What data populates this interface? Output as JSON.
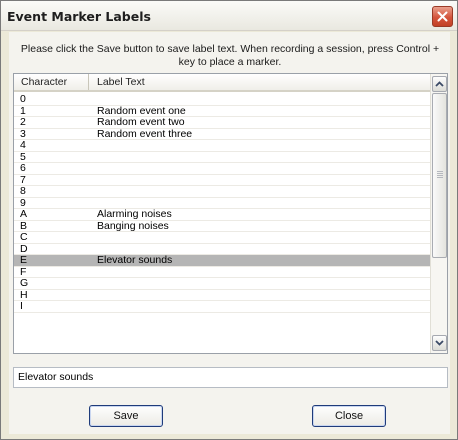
{
  "window": {
    "title": "Event Marker Labels"
  },
  "instructions": "Please click the Save button to save label text. When recording a session, press Control + key to place a marker.",
  "list": {
    "columns": [
      "Character",
      "Label Text"
    ],
    "rows": [
      {
        "character": "0",
        "label": ""
      },
      {
        "character": "1",
        "label": "Random event one"
      },
      {
        "character": "2",
        "label": "Random event two"
      },
      {
        "character": "3",
        "label": "Random event three"
      },
      {
        "character": "4",
        "label": ""
      },
      {
        "character": "5",
        "label": ""
      },
      {
        "character": "6",
        "label": ""
      },
      {
        "character": "7",
        "label": ""
      },
      {
        "character": "8",
        "label": ""
      },
      {
        "character": "9",
        "label": ""
      },
      {
        "character": "A",
        "label": "Alarming noises"
      },
      {
        "character": "B",
        "label": "Banging noises"
      },
      {
        "character": "C",
        "label": ""
      },
      {
        "character": "D",
        "label": ""
      },
      {
        "character": "E",
        "label": "Elevator sounds"
      },
      {
        "character": "F",
        "label": ""
      },
      {
        "character": "G",
        "label": ""
      },
      {
        "character": "H",
        "label": ""
      },
      {
        "character": "I",
        "label": ""
      }
    ],
    "selected_character": "E"
  },
  "edit_value": "Elevator sounds",
  "buttons": {
    "save": "Save",
    "close": "Close"
  },
  "colors": {
    "selected_row": "#b5b5b5",
    "title_close": "#d4543c"
  }
}
